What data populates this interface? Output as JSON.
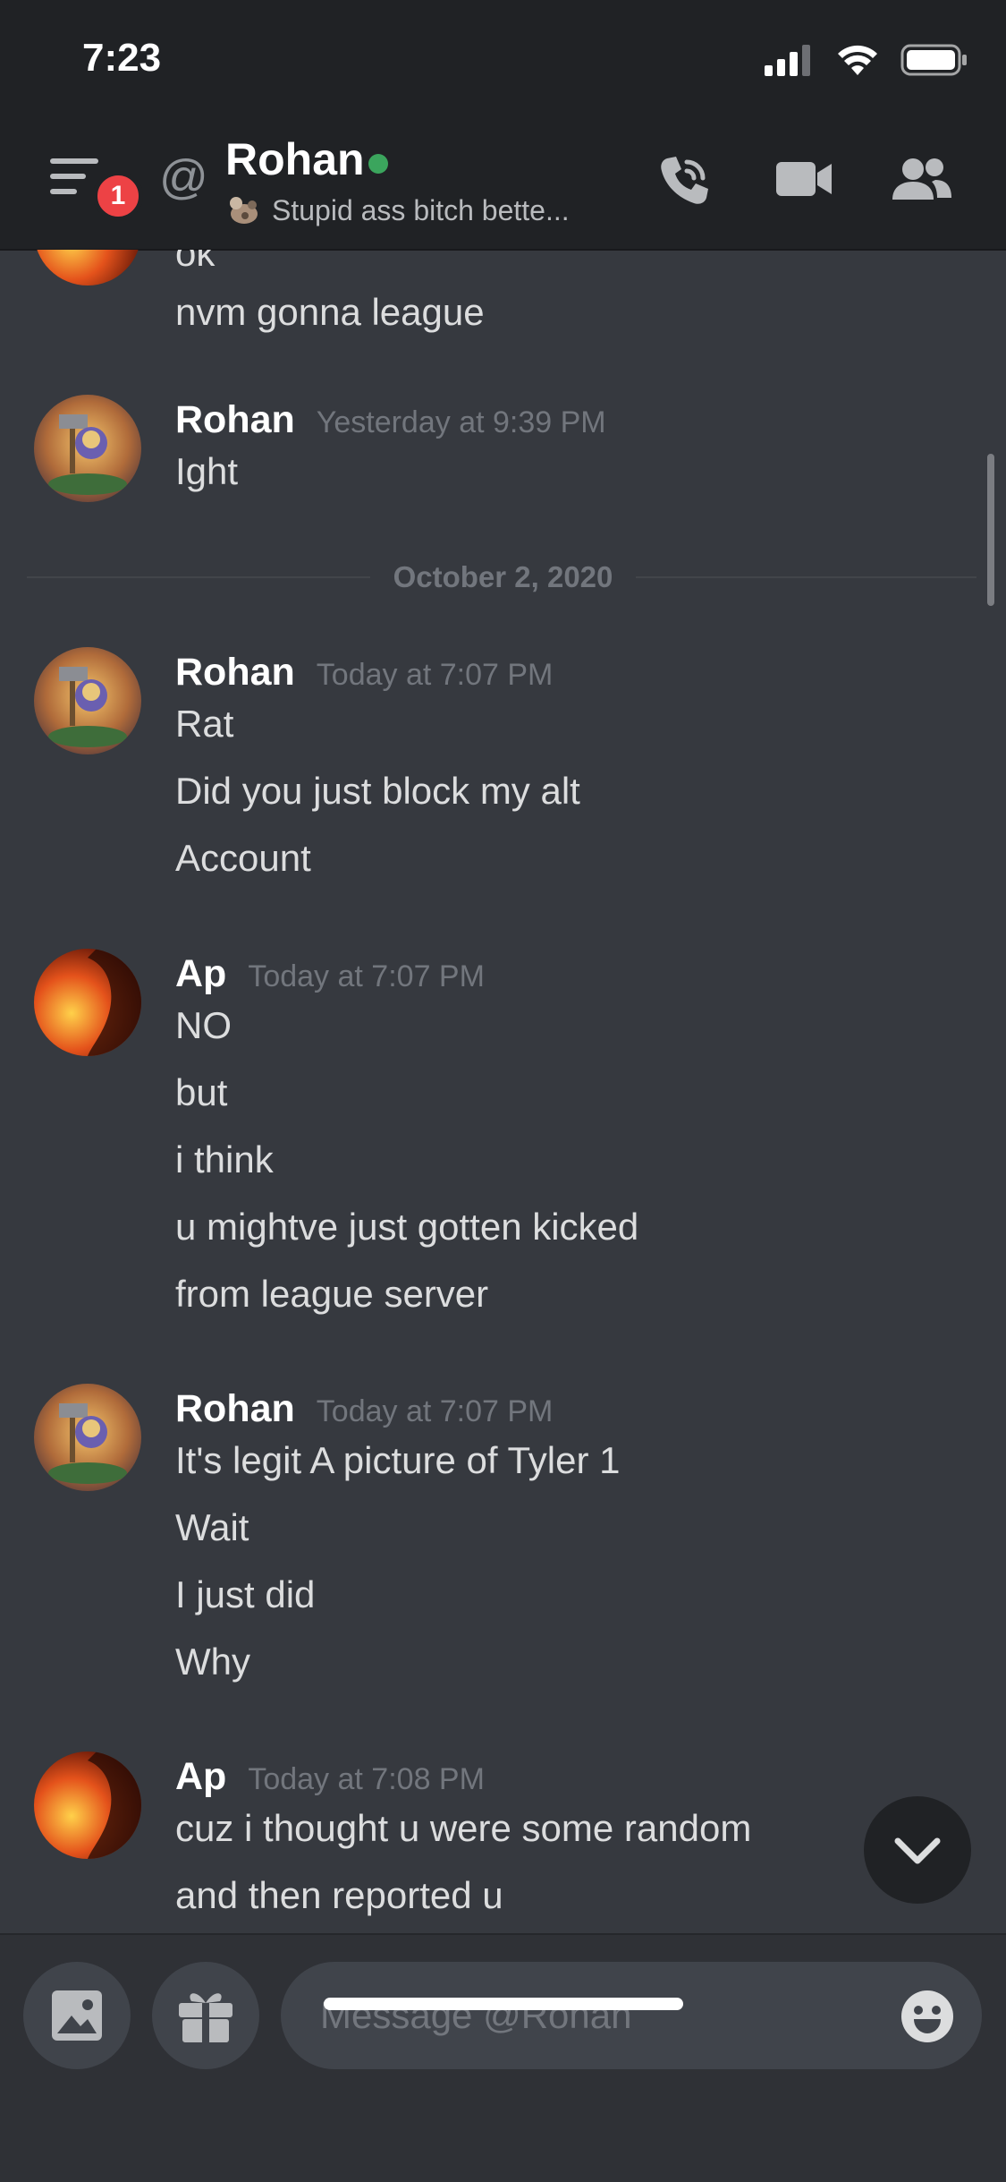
{
  "status_bar": {
    "time": "7:23"
  },
  "header": {
    "unread_count": "1",
    "at_symbol": "@",
    "title": "Rohan",
    "custom_status": "Stupid ass bitch bette...",
    "icons": [
      "menu-icon",
      "call-icon",
      "video-icon",
      "members-icon"
    ]
  },
  "messages": [
    {
      "author": "",
      "timestamp": "",
      "lines": [
        "ok",
        "nvm gonna league"
      ]
    },
    {
      "author": "Rohan",
      "timestamp": "Yesterday at 9:39 PM",
      "lines": [
        "Ight"
      ]
    },
    {
      "author": "Rohan",
      "timestamp": "Today at 7:07 PM",
      "lines": [
        "Rat",
        "Did you just block my alt",
        "Account"
      ]
    },
    {
      "author": "Ap",
      "timestamp": "Today at 7:07 PM",
      "lines": [
        "NO",
        "but",
        "i think",
        "u mightve just gotten kicked",
        "from league server"
      ]
    },
    {
      "author": "Rohan",
      "timestamp": "Today at 7:07 PM",
      "lines": [
        "It's legit A picture of Tyler 1",
        "Wait",
        "I just did",
        "Why"
      ]
    },
    {
      "author": "Ap",
      "timestamp": "Today at 7:08 PM",
      "lines": [
        "cuz i thought u were some random",
        "and then reported u"
      ]
    }
  ],
  "date_divider": "October 2, 2020",
  "composer": {
    "placeholder": "Message @Rohan"
  },
  "colors": {
    "background": "#36393f",
    "header": "#202225",
    "online": "#3ba55d",
    "badge": "#ed4245"
  }
}
